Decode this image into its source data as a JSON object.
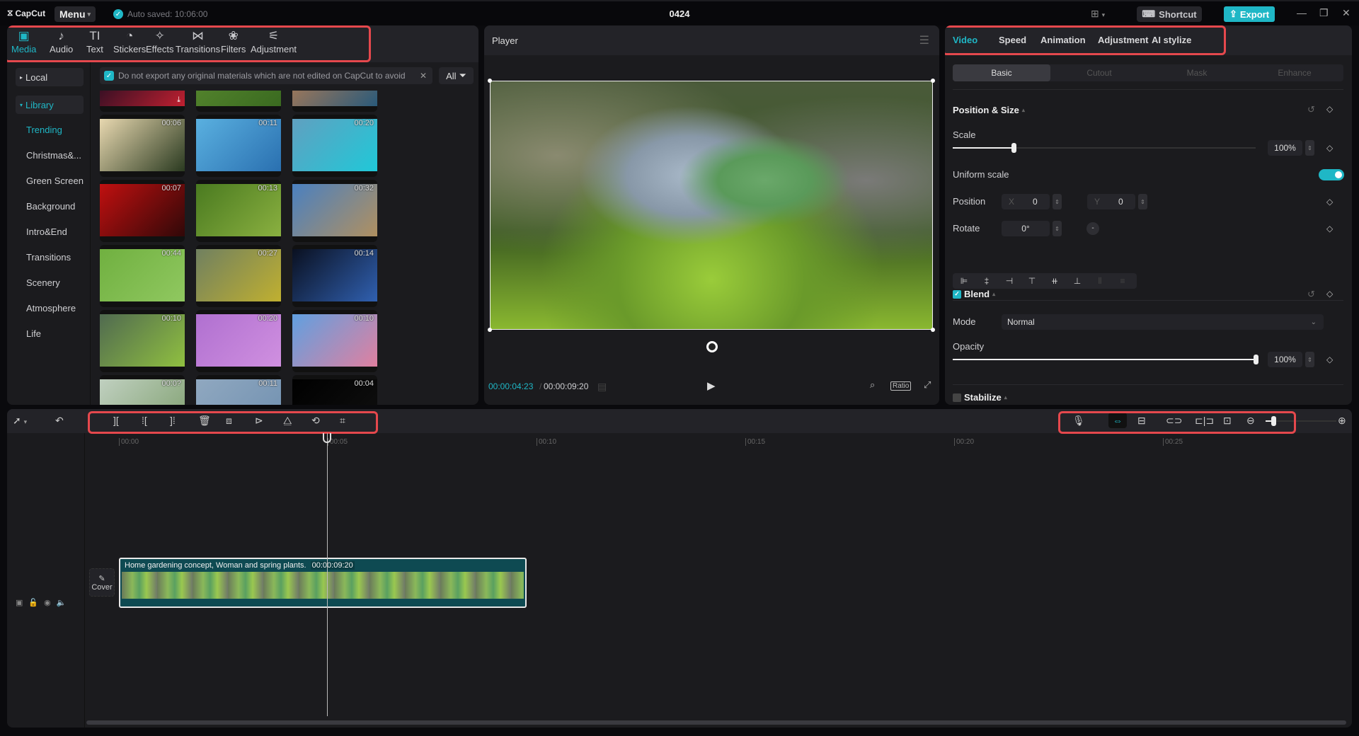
{
  "app": {
    "logo": "CapCut",
    "menu_label": "Menu",
    "autosave": "Auto saved: 10:06:00",
    "project_title": "0424",
    "shortcut_label": "Shortcut",
    "export_label": "Export"
  },
  "media_tabs": [
    {
      "label": "Media",
      "icon": "media-icon",
      "glyph": "▣",
      "active": true
    },
    {
      "label": "Audio",
      "icon": "audio-icon",
      "glyph": "♪"
    },
    {
      "label": "Text",
      "icon": "text-icon",
      "glyph": "TI"
    },
    {
      "label": "Stickers",
      "icon": "sticker-icon",
      "glyph": "◔"
    },
    {
      "label": "Effects",
      "icon": "effects-icon",
      "glyph": "✧"
    },
    {
      "label": "Transitions",
      "icon": "transitions-icon",
      "glyph": "⋈"
    },
    {
      "label": "Filters",
      "icon": "filters-icon",
      "glyph": "❀"
    },
    {
      "label": "Adjustment",
      "icon": "adjustment-icon",
      "glyph": "⚟"
    }
  ],
  "sidebar": {
    "local": "Local",
    "library": "Library",
    "categories": [
      "Trending",
      "Christmas&...",
      "Green Screen",
      "Background",
      "Intro&End",
      "Transitions",
      "Scenery",
      "Atmosphere",
      "Life"
    ]
  },
  "notice": "Do not export any original materials which are not edited on CapCut to avoid",
  "filter_label": "All",
  "thumbs": [
    {
      "dur": "",
      "download": true,
      "c1": "#0a0a20",
      "c2": "#c02030"
    },
    {
      "dur": "",
      "c1": "#5a8a30",
      "c2": "#3a6a20"
    },
    {
      "dur": "",
      "c1": "#c08050",
      "c2": "#2a5a7a"
    },
    {
      "dur": "00:06",
      "c1": "#e8d8b0",
      "c2": "#2a3a20"
    },
    {
      "dur": "00:11",
      "c1": "#5ab0e0",
      "c2": "#2a70b0"
    },
    {
      "dur": "00:20",
      "c1": "#60a0c0",
      "c2": "#20c8d8"
    },
    {
      "dur": "00:07",
      "c1": "#c01010",
      "c2": "#300808"
    },
    {
      "dur": "00:13",
      "c1": "#4a7a20",
      "c2": "#8ab040"
    },
    {
      "dur": "00:32",
      "c1": "#4a80c0",
      "c2": "#b09060"
    },
    {
      "dur": "00:44",
      "c1": "#70b040",
      "c2": "#90c860"
    },
    {
      "dur": "00:27",
      "c1": "#708060",
      "c2": "#c0b030"
    },
    {
      "dur": "00:14",
      "c1": "#0a1020",
      "c2": "#3060b0"
    },
    {
      "dur": "00:10",
      "c1": "#506a50",
      "c2": "#90c040"
    },
    {
      "dur": "00:20",
      "c1": "#b070d0",
      "c2": "#d090e0"
    },
    {
      "dur": "00:10",
      "c1": "#60a0e0",
      "c2": "#e080a0"
    },
    {
      "dur": "00:0?",
      "c1": "#c0d0c0",
      "c2": "#80a070"
    },
    {
      "dur": "00:11",
      "c1": "#90a8c0",
      "c2": "#7090b0"
    },
    {
      "dur": "00:04",
      "c1": "#000000",
      "c2": "#101010"
    }
  ],
  "player": {
    "title": "Player",
    "current_time": "00:00:04:23",
    "total_time": "00:00:09:20",
    "ratio_label": "Ratio"
  },
  "right_panel": {
    "tabs": [
      "Video",
      "Speed",
      "Animation",
      "Adjustment",
      "AI stylize"
    ],
    "active_tab": "Video",
    "subtabs": [
      "Basic",
      "Cutout",
      "Mask",
      "Enhance"
    ],
    "position_size": {
      "title": "Position & Size",
      "scale_label": "Scale",
      "scale_value": "100%",
      "scale_fraction": 0.2,
      "uniform_scale_label": "Uniform scale",
      "uniform_scale_on": true,
      "position_label": "Position",
      "x_label": "X",
      "x_value": "0",
      "y_label": "Y",
      "y_value": "0",
      "rotate_label": "Rotate",
      "rotate_value": "0°"
    },
    "blend": {
      "title": "Blend",
      "enabled": true,
      "mode_label": "Mode",
      "mode_value": "Normal",
      "opacity_label": "Opacity",
      "opacity_value": "100%",
      "opacity_fraction": 1.0
    },
    "stabilize": {
      "title": "Stabilize",
      "enabled": false
    }
  },
  "timeline": {
    "ticks": [
      "00:00",
      "00:05",
      "00:10",
      "00:15",
      "00:20",
      "00:25"
    ],
    "cover_label": "Cover",
    "clip": {
      "title": "Home gardening concept, Woman and spring plants.",
      "duration": "00:00:09:20"
    }
  },
  "colors": {
    "accent": "#1fb7c6",
    "highlight": "#e5484d"
  }
}
